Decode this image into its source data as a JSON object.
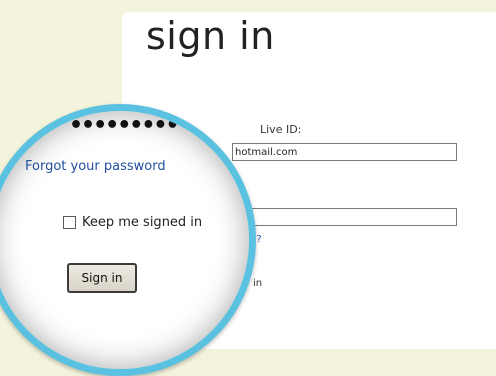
{
  "header": {
    "title": "sign in"
  },
  "form": {
    "live_id_label": "Live ID:",
    "email_value": "hotmail.com",
    "password_dots": "•••",
    "forgot_partial": "d?",
    "keep_partial": "in"
  },
  "magnifier": {
    "password_dots": "•••••••••••",
    "forgot_link": "Forgot your password",
    "keep_signed_in_label": "Keep me signed in",
    "sign_in_button": "Sign in",
    "ring_color": "#5ac2e0"
  }
}
